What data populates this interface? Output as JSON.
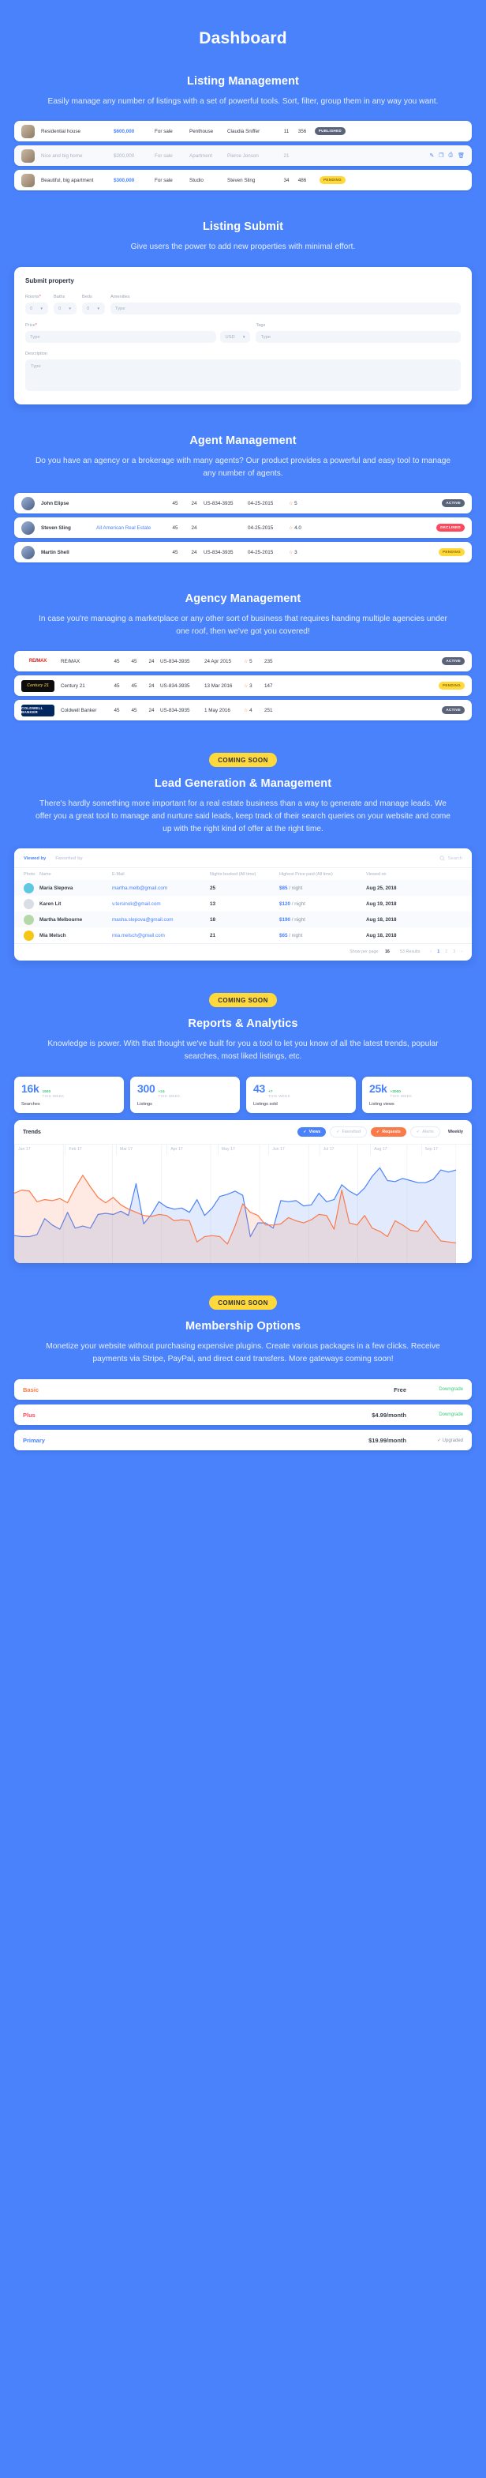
{
  "page_title": "Dashboard",
  "theme": {
    "bg": "#4a82fb",
    "accent": "#4a82fb",
    "yellow": "#ffd93b",
    "green": "#43c97e",
    "red": "#fb4a5e",
    "orange": "#fb7a4a"
  },
  "sections": {
    "listing_management": {
      "title": "Listing Management",
      "desc": "Easily manage any number of listings with a set of powerful tools. Sort, filter, group them in any way you want.",
      "rows": [
        {
          "name": "Residential house",
          "price": "$600,000",
          "status": "For sale",
          "type": "Penthouse",
          "agent": "Claudia Sniffer",
          "num1": "11",
          "num2": "356",
          "badge": "PUBLISHED",
          "badge_kind": "published"
        },
        {
          "name": "Nice and big home",
          "price": "$200,000",
          "status": "For sale",
          "type": "Apartment",
          "agent": "Pierce Jonson",
          "num1": "21",
          "num2": "",
          "badge": "",
          "badge_kind": "actions"
        },
        {
          "name": "Beautiful, big apartment",
          "price": "$300,000",
          "status": "For sale",
          "type": "Studio",
          "agent": "Steven Sling",
          "num1": "34",
          "num2": "486",
          "badge": "PENDING",
          "badge_kind": "pending"
        }
      ],
      "row_actions": [
        "edit-icon",
        "copy-icon",
        "print-icon",
        "trash-icon"
      ]
    },
    "listing_submit": {
      "title": "Listing Submit",
      "desc": "Give users the power to add new properties with minimal effort.",
      "form": {
        "title": "Submit property",
        "rooms_label": "Rooms",
        "rooms_required": "*",
        "rooms_value": "0",
        "baths_label": "Baths",
        "baths_value": "0",
        "beds_label": "Beds",
        "beds_value": "0",
        "amenities_label": "Amenities",
        "amenities_placeholder": "Type",
        "price_label": "Price",
        "price_required": "*",
        "price_placeholder": "Type",
        "currency_value": "USD",
        "tags_label": "Tags",
        "tags_placeholder": "Type",
        "description_label": "Description",
        "description_placeholder": "Type"
      }
    },
    "agent_management": {
      "title": "Agent Management",
      "desc": "Do you have an agency or a brokerage with many agents? Our product provides a powerful and easy tool to manage any number of agents.",
      "rows": [
        {
          "name": "John Elipse",
          "agency": "",
          "num1": "45",
          "num2": "24",
          "license": "US-834-3935",
          "date": "04-25-2015",
          "rating": "5",
          "badge": "ACTIVE",
          "badge_kind": "active"
        },
        {
          "name": "Steven Sling",
          "agency": "All American Real Estate",
          "num1": "45",
          "num2": "24",
          "license": "",
          "date": "04-25-2015",
          "rating": "4.0",
          "badge": "DECLINED",
          "badge_kind": "declined"
        },
        {
          "name": "Martin Shell",
          "agency": "",
          "num1": "45",
          "num2": "24",
          "license": "US-834-3935",
          "date": "04-25-2015",
          "rating": "3",
          "badge": "PENDING",
          "badge_kind": "pending"
        }
      ]
    },
    "agency_management": {
      "title": "Agency Management",
      "desc": "In case you're managing a marketplace or any other sort of business that requires handing multiple agencies under one roof, then we've got you covered!",
      "rows": [
        {
          "logo": "RE/MAX",
          "name": "RE/MAX",
          "num1": "45",
          "num2": "45",
          "num3": "24",
          "license": "US-834-3935",
          "date": "24 Apr 2015",
          "rating": "5",
          "listings": "235",
          "badge": "ACTIVE",
          "badge_kind": "active"
        },
        {
          "logo": "Century 21",
          "name": "Century 21",
          "num1": "45",
          "num2": "45",
          "num3": "24",
          "license": "US-834-3935",
          "date": "13 Mar 2016",
          "rating": "3",
          "listings": "147",
          "badge": "PENDING",
          "badge_kind": "pending"
        },
        {
          "logo": "COLDWELL BANKER",
          "name": "Coldwell Banker",
          "num1": "45",
          "num2": "45",
          "num3": "24",
          "license": "US-834-3935",
          "date": "1 May 2016",
          "rating": "4",
          "listings": "251",
          "badge": "ACTIVE",
          "badge_kind": "active"
        }
      ]
    },
    "lead_generation": {
      "badge": "COMING SOON",
      "title": "Lead Generation & Management",
      "desc": "There's hardly something more important for a real estate business than a way to generate and manage leads. We offer you a great tool to manage and nurture said leads, keep track of their search queries on your website and come up with the right kind of offer at the right time.",
      "tabs": [
        {
          "label": "Viewed by",
          "active": true
        },
        {
          "label": "Favorited by",
          "active": false
        }
      ],
      "search_placeholder": "Search",
      "columns": [
        "Photo",
        "Name",
        "E-Mail",
        "Nights booked (All time)",
        "Highest Price paid (All time)",
        "Viewed on"
      ],
      "rows": [
        {
          "name": "Maria Slepova",
          "email": "martha.melb@gmail.com",
          "nights": "25",
          "price": "$85",
          "per": "/ night",
          "viewed": "Aug 25, 2018",
          "avatar": "#5ec8e0"
        },
        {
          "name": "Karen Lit",
          "email": "v.tersinok@gmail.com",
          "nights": "13",
          "price": "$120",
          "per": "/ night",
          "viewed": "Aug 19, 2018",
          "avatar": "#d8dde6"
        },
        {
          "name": "Martha Melbourne",
          "email": "masha.slepova@gmail.com",
          "nights": "18",
          "price": "$190",
          "per": "/ night",
          "viewed": "Aug 18, 2018",
          "avatar": "#b6d8a8"
        },
        {
          "name": "Mia Melsch",
          "email": "mia.melsch@gmail.com",
          "nights": "21",
          "price": "$65",
          "per": "/ night",
          "viewed": "Aug 18, 2018",
          "avatar": "#f5c518"
        }
      ],
      "footer": {
        "show_per_page_label": "Show per page:",
        "show_per_page_value": "16",
        "results": "53 Results",
        "pages": [
          "1",
          "2",
          "3"
        ],
        "active_page": "1",
        "prev": "‹",
        "next": "›"
      }
    },
    "reports": {
      "badge": "COMING SOON",
      "title": "Reports & Analytics",
      "desc": "Knowledge is power. With that thought we've built for you a tool to let you know of all the latest trends, popular searches, most liked listings, etc.",
      "stats": [
        {
          "value": "16k",
          "delta": "1500",
          "period": "THIS WEEK",
          "label": "Searches"
        },
        {
          "value": "300",
          "delta": "+24",
          "period": "THIS WEEK",
          "label": "Listings"
        },
        {
          "value": "43",
          "delta": "+7",
          "period": "THIS WEEK",
          "label": "Listings sold"
        },
        {
          "value": "25k",
          "delta": "+3000",
          "period": "THIS WEEK",
          "label": "Listing views"
        }
      ],
      "chart_controls": {
        "title": "Trends",
        "chips": [
          {
            "label": "Views",
            "on": true,
            "color": "blue"
          },
          {
            "label": "Favorited",
            "on": false,
            "color": "off"
          },
          {
            "label": "Requests",
            "on": true,
            "color": "orange"
          },
          {
            "label": "Alerts",
            "on": false,
            "color": "off"
          }
        ],
        "period": "Weekly"
      }
    },
    "membership": {
      "badge": "COMING SOON",
      "title": "Membership Options",
      "desc": "Monetize your website without purchasing expensive plugins. Create various packages in a few clicks. Receive payments via Stripe, PayPal, and direct card transfers. More gateways coming soon!",
      "plans": [
        {
          "name": "Basic",
          "color": "#fb7a4a",
          "price": "Free",
          "action": "Downgrade",
          "action_kind": "down"
        },
        {
          "name": "Plus",
          "color": "#fb4a5e",
          "price": "$4.99/month",
          "action": "Downgrade",
          "action_kind": "down"
        },
        {
          "name": "Primary",
          "color": "#4a82fb",
          "price": "$19.99/month",
          "action": "✓  Upgraded",
          "action_kind": "up"
        }
      ]
    }
  },
  "chart_data": {
    "type": "area",
    "title": "Trends",
    "xlabel": "",
    "ylabel": "",
    "grid": true,
    "legend_position": "top-right",
    "categories": [
      "Jan 17",
      "Feb 17",
      "Mar 17",
      "Apr 17",
      "May 17",
      "Jun 17",
      "Jul 17",
      "Aug 17",
      "Sep 17"
    ],
    "series": [
      {
        "name": "Views",
        "color": "#4a82fb",
        "values": [
          26,
          25,
          25,
          27,
          42,
          36,
          32,
          48,
          33,
          35,
          33,
          46,
          47,
          46,
          49,
          45,
          75,
          37,
          46,
          58,
          53,
          51,
          52,
          48,
          60,
          45,
          52,
          63,
          65,
          68,
          64,
          25,
          38,
          38,
          33,
          59,
          58,
          59,
          54,
          55,
          66,
          58,
          60,
          74,
          68,
          64,
          71,
          82,
          90,
          78,
          77,
          80,
          78,
          76,
          76,
          79,
          88,
          86,
          88
        ]
      },
      {
        "name": "Requests",
        "color": "#fb7a4a",
        "values": [
          66,
          69,
          68,
          58,
          60,
          59,
          61,
          57,
          71,
          83,
          72,
          62,
          57,
          62,
          55,
          51,
          48,
          45,
          44,
          46,
          45,
          40,
          41,
          40,
          20,
          25,
          26,
          25,
          18,
          35,
          56,
          48,
          45,
          36,
          36,
          37,
          43,
          40,
          38,
          41,
          46,
          45,
          32,
          69,
          38,
          36,
          45,
          33,
          30,
          25,
          40,
          36,
          31,
          30,
          40,
          30,
          21,
          20,
          19
        ]
      }
    ]
  }
}
